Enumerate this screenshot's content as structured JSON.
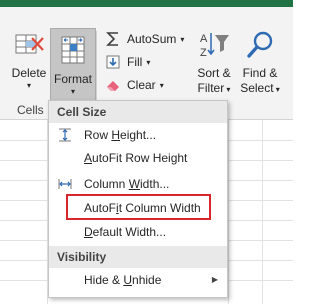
{
  "ribbon": {
    "cells_group": {
      "delete": {
        "label": "Delete",
        "icon": "delete-cells-icon"
      },
      "format": {
        "label": "Format",
        "icon": "format-cells-icon"
      },
      "group_label": "Cells"
    },
    "editing_group": {
      "autosum": {
        "label": "AutoSum",
        "icon": "sigma-icon"
      },
      "fill": {
        "label": "Fill",
        "icon": "fill-down-icon"
      },
      "clear": {
        "label": "Clear",
        "icon": "eraser-icon"
      },
      "sort_filter": {
        "line1": "Sort &",
        "line2": "Filter",
        "icon": "sort-filter-icon"
      },
      "find_select": {
        "line1": "Find &",
        "line2": "Select",
        "icon": "magnifier-icon"
      }
    }
  },
  "format_menu": {
    "sections": [
      {
        "header": "Cell Size"
      },
      {
        "header": "Visibility"
      }
    ],
    "items": {
      "row_height": {
        "pre": "Row ",
        "accel": "H",
        "post": "eight..."
      },
      "autofit_row": {
        "pre": "",
        "accel": "A",
        "post": "utoFit Row Height"
      },
      "column_width": {
        "pre": "Column ",
        "accel": "W",
        "post": "idth..."
      },
      "autofit_column": {
        "pre": "AutoF",
        "accel": "i",
        "post": "t Column Width"
      },
      "default_width": {
        "pre": "",
        "accel": "D",
        "post": "efault Width..."
      },
      "hide_unhide": {
        "pre": "Hide & ",
        "accel": "U",
        "post": "nhide"
      }
    }
  },
  "colors": {
    "accent_green": "#217346",
    "highlight_red": "#d9262c",
    "format_pressed": "#c5c5c5"
  }
}
